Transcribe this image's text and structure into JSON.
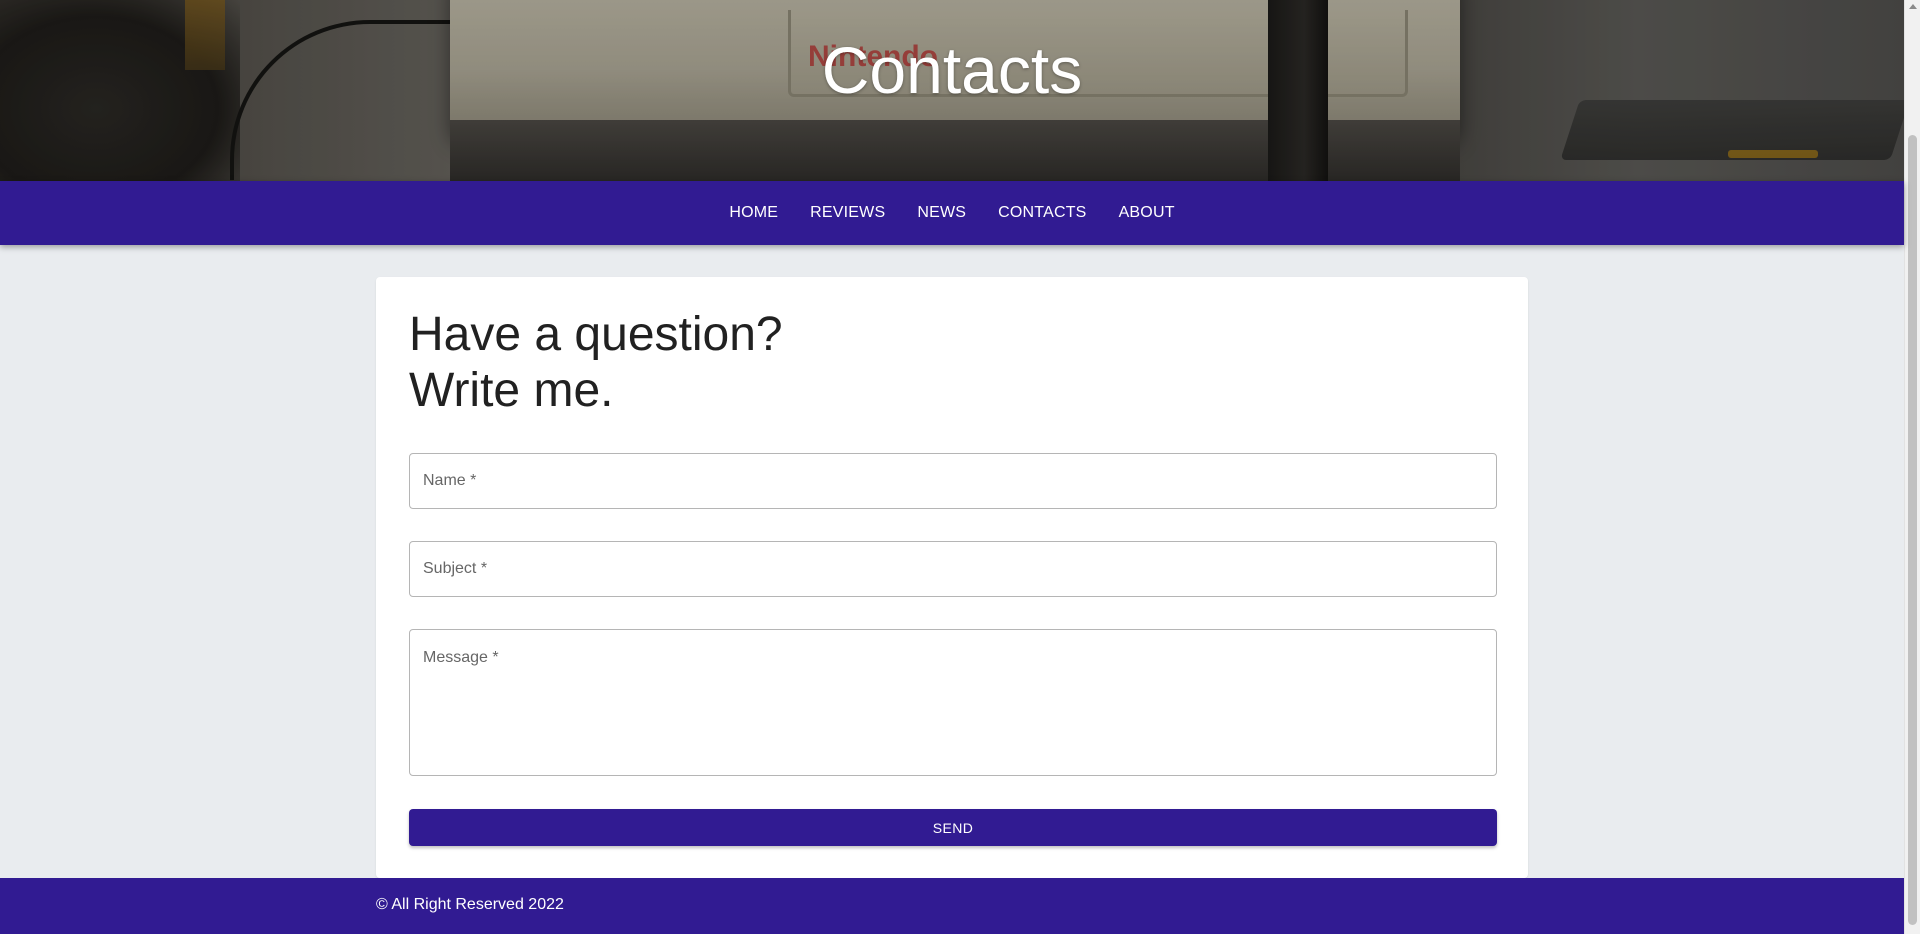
{
  "hero": {
    "title": "Contacts",
    "background_logo_text": "Nintendo"
  },
  "nav": {
    "items": [
      {
        "label": "HOME"
      },
      {
        "label": "REVIEWS"
      },
      {
        "label": "NEWS"
      },
      {
        "label": "CONTACTS"
      },
      {
        "label": "ABOUT"
      }
    ]
  },
  "contact_form": {
    "heading_line1": "Have a question?",
    "heading_line2": "Write me.",
    "name_placeholder": "Name *",
    "name_value": "",
    "subject_placeholder": "Subject *",
    "subject_value": "",
    "message_placeholder": "Message *",
    "message_value": "",
    "send_label": "SEND"
  },
  "footer": {
    "copyright": "© All Right Reserved 2022"
  },
  "colors": {
    "primary": "#311b92",
    "page_background": "#e9ecef",
    "card_background": "#ffffff",
    "text": "#212121"
  }
}
